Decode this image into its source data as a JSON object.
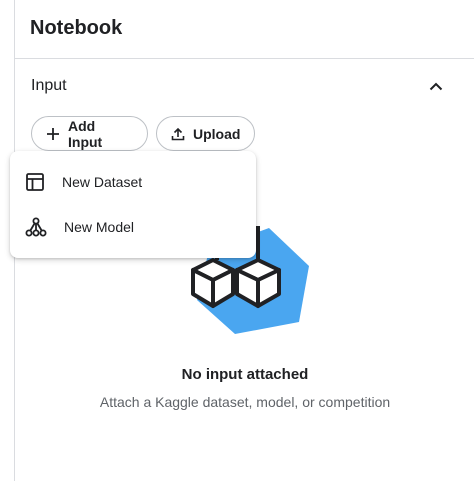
{
  "header": {
    "title": "Notebook"
  },
  "section": {
    "title": "Input",
    "collapse_icon": "chevron-up-icon"
  },
  "actions": {
    "add_input": {
      "label": "Add Input",
      "icon": "plus-icon"
    },
    "upload": {
      "label": "Upload",
      "icon": "upload-icon"
    }
  },
  "menu": {
    "items": [
      {
        "label": "New Dataset",
        "icon": "table-icon"
      },
      {
        "label": "New Model",
        "icon": "model-graph-icon"
      }
    ]
  },
  "empty_state": {
    "title": "No input attached",
    "subtitle": "Attach a Kaggle dataset, model, or competition",
    "illustration_color": "#4aa6f0"
  }
}
